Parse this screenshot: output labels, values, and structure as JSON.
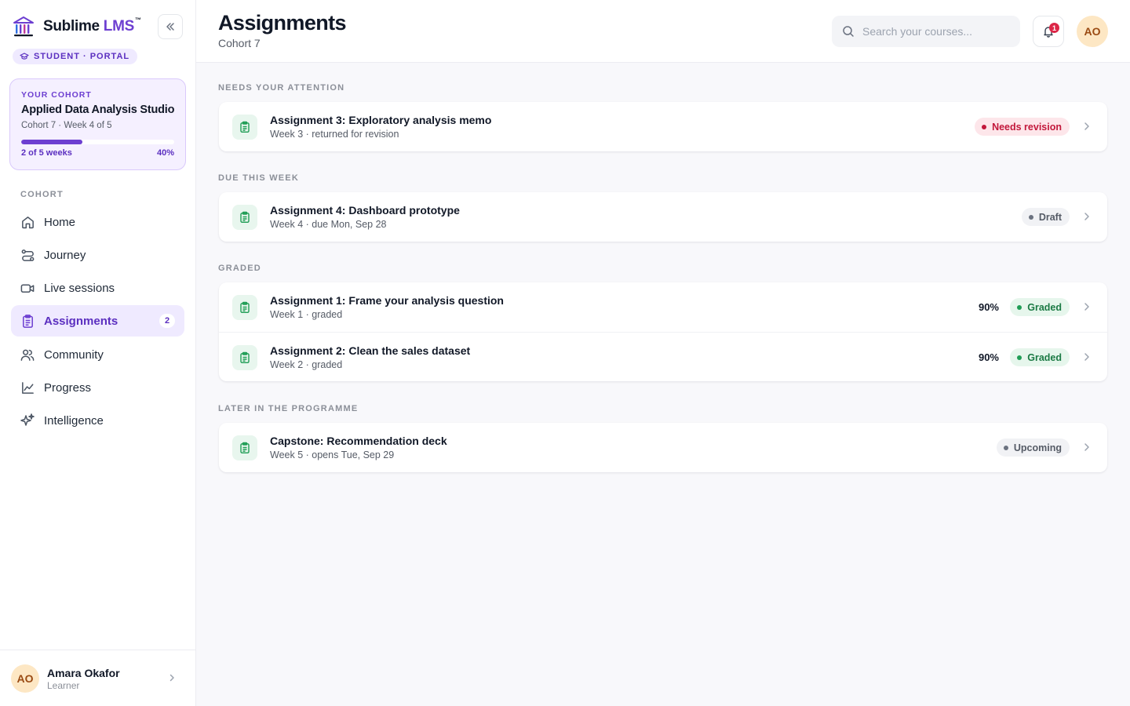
{
  "brand": {
    "name": "Sublime",
    "accent": "LMS",
    "trademark": "™",
    "portal_badge": "STUDENT · PORTAL",
    "colors": {
      "primary": "#6d3fd1",
      "success": "#1f9d55",
      "danger": "#c2183b"
    }
  },
  "cohort_card": {
    "eyebrow": "YOUR COHORT",
    "title": "Applied Data Analysis Studio",
    "subtitle": "Cohort 7 · Week 4 of 5",
    "progress_fraction": 0.4,
    "progress_left": "2 of 5 weeks",
    "progress_right": "40%"
  },
  "nav": {
    "section_label": "COHORT",
    "items": [
      {
        "label": "Home",
        "icon": "home-icon"
      },
      {
        "label": "Journey",
        "icon": "route-icon"
      },
      {
        "label": "Live sessions",
        "icon": "video-icon"
      },
      {
        "label": "Assignments",
        "icon": "clipboard-icon",
        "count": "2",
        "active": true
      },
      {
        "label": "Community",
        "icon": "users-icon"
      },
      {
        "label": "Progress",
        "icon": "chart-line-icon"
      },
      {
        "label": "Intelligence",
        "icon": "sparkles-icon"
      }
    ]
  },
  "user": {
    "initials": "AO",
    "name": "Amara Okafor",
    "role": "Learner"
  },
  "header": {
    "title": "Assignments",
    "subtitle": "Cohort 7",
    "search_placeholder": "Search your courses...",
    "notification_count": "1",
    "avatar_initials": "AO"
  },
  "sections": [
    {
      "label": "NEEDS YOUR ATTENTION",
      "items": [
        {
          "title": "Assignment 3: Exploratory analysis memo",
          "meta": "Week 3 · returned for revision",
          "status": "Needs revision",
          "tone": "danger"
        }
      ]
    },
    {
      "label": "DUE THIS WEEK",
      "items": [
        {
          "title": "Assignment 4: Dashboard prototype",
          "meta": "Week 4 · due Mon, Sep 28",
          "status": "Draft",
          "tone": "neutral"
        }
      ]
    },
    {
      "label": "GRADED",
      "items": [
        {
          "title": "Assignment 1: Frame your analysis question",
          "meta": "Week 1 · graded",
          "score": "90%",
          "status": "Graded",
          "tone": "success"
        },
        {
          "title": "Assignment 2: Clean the sales dataset",
          "meta": "Week 2 · graded",
          "score": "90%",
          "status": "Graded",
          "tone": "success"
        }
      ]
    },
    {
      "label": "LATER IN THE PROGRAMME",
      "items": [
        {
          "title": "Capstone: Recommendation deck",
          "meta": "Week 5 · opens Tue, Sep 29",
          "status": "Upcoming",
          "tone": "neutral"
        }
      ]
    }
  ]
}
